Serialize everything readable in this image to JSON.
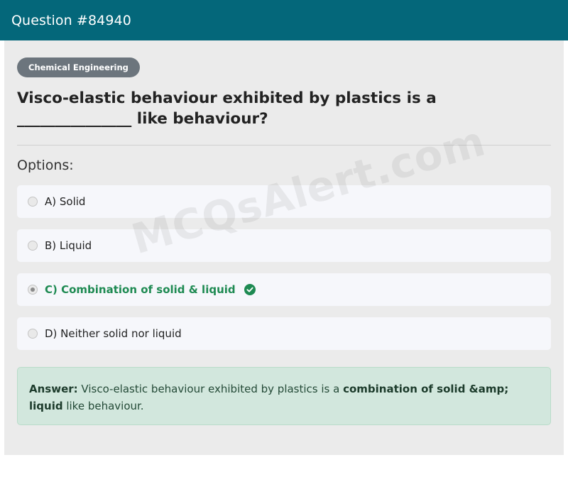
{
  "header": {
    "title": "Question #84940"
  },
  "badge": {
    "label": "Chemical Engineering"
  },
  "question": {
    "text": "Visco-elastic behaviour exhibited by plastics is a _______________ like behaviour?"
  },
  "options_label": "Options:",
  "options": [
    {
      "label": "A) Solid",
      "selected": false,
      "correct": false
    },
    {
      "label": "B) Liquid",
      "selected": false,
      "correct": false
    },
    {
      "label": "C) Combination of solid & liquid",
      "selected": true,
      "correct": true
    },
    {
      "label": "D) Neither solid nor liquid",
      "selected": false,
      "correct": false
    }
  ],
  "answer": {
    "prefix": "Answer:",
    "text_before": " Visco-elastic behaviour exhibited by plastics is a ",
    "highlight": "combination of solid &amp; liquid",
    "text_after": " like behaviour."
  },
  "watermark": "MCQsAlert.com",
  "colors": {
    "header_bg": "#04677a",
    "correct_green": "#1e8a52",
    "answer_bg": "#d2e7dd"
  },
  "icons": {
    "correct": "check-circle-icon"
  }
}
